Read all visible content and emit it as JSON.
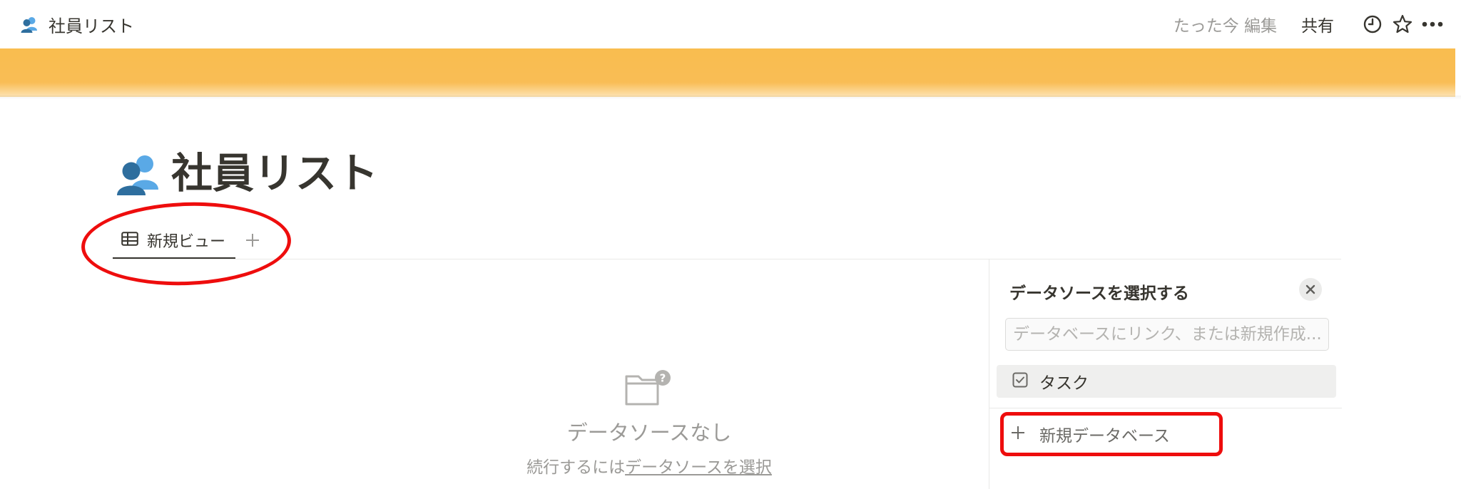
{
  "topbar": {
    "page_icon": "people-icon",
    "page_title": "社員リスト",
    "edited_status": "たった今 編集",
    "share_label": "共有",
    "icons": [
      "clock-icon",
      "star-icon",
      "more-icon"
    ]
  },
  "cover": {
    "color": "#f9bd4f"
  },
  "page": {
    "icon": "people-icon",
    "title": "社員リスト"
  },
  "views": {
    "tabs": [
      {
        "icon": "table-icon",
        "label": "新規ビュー",
        "active": true
      }
    ],
    "add_icon": "plus-icon"
  },
  "empty_state": {
    "icon": "folder-question-icon",
    "title": "データソースなし",
    "subtitle_prefix": "続行するには",
    "subtitle_link": "データソースを選択"
  },
  "datasource_panel": {
    "title": "データソースを選択する",
    "close_icon": "close-icon",
    "search_placeholder": "データベースにリンク、または新規作成...",
    "items": [
      {
        "icon": "checkbox-icon",
        "label": "タスク"
      }
    ],
    "new_database_label": "新規データベース",
    "new_database_icon": "plus-icon"
  },
  "annotations": {
    "color": "#ee0d0d"
  }
}
